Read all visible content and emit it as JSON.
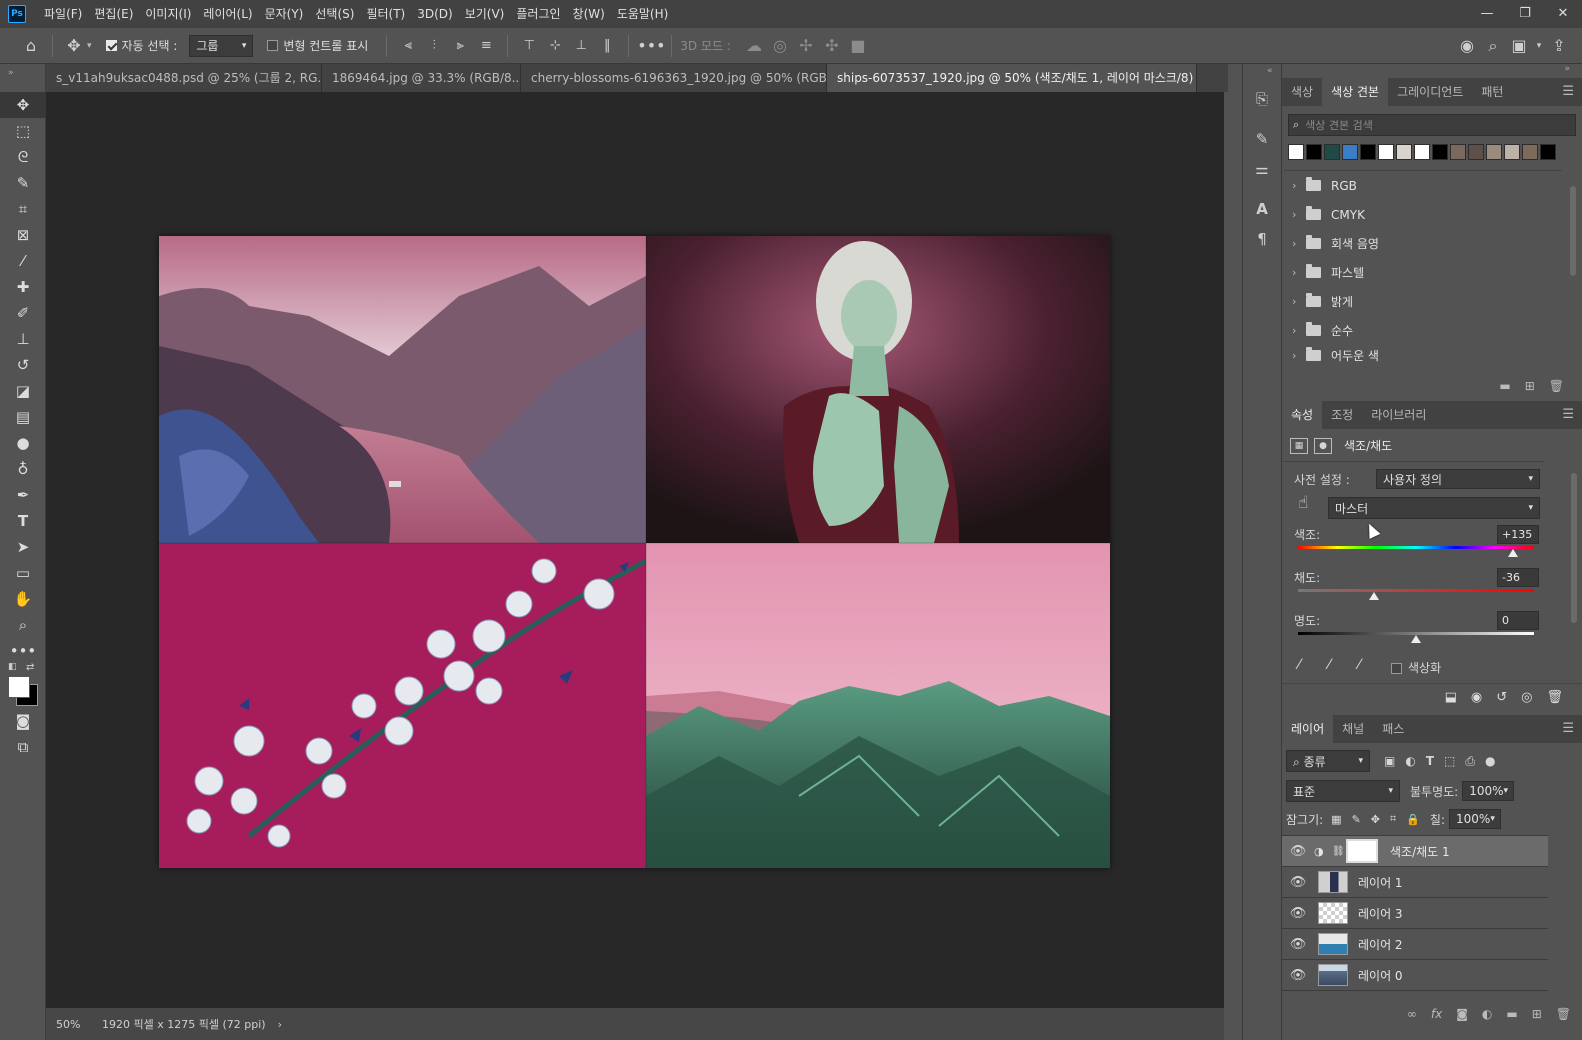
{
  "app": {
    "logo": "Ps"
  },
  "menubar": [
    "파일(F)",
    "편집(E)",
    "이미지(I)",
    "레이어(L)",
    "문자(Y)",
    "선택(S)",
    "필터(T)",
    "3D(D)",
    "보기(V)",
    "플러그인",
    "창(W)",
    "도움말(H)"
  ],
  "options": {
    "auto_select_label": "자동 선택 :",
    "auto_select_value": "그룹",
    "transform_label": "변형 컨트롤 표시",
    "mode_3d_label": "3D 모드 :"
  },
  "tabs": [
    {
      "label": "s_v11ah9uksac0488.psd @ 25% (그룹 2, RG...",
      "close": "×"
    },
    {
      "label": "1869464.jpg @ 33.3% (RGB/8...",
      "close": "×"
    },
    {
      "label": "cherry-blossoms-6196363_1920.jpg @ 50% (RGB/...",
      "close": "×"
    },
    {
      "label": "ships-6073537_1920.jpg @ 50% (색조/채도 1, 레이어 마스크/8) *",
      "close": "×"
    }
  ],
  "status": {
    "zoom": "50%",
    "doc_info": "1920 픽셀 x 1275 픽셀 (72 ppi)",
    "arrow": "›"
  },
  "swatches_panel": {
    "tabs": [
      "색상",
      "색상 견본",
      "그레이디언트",
      "패턴"
    ],
    "search_placeholder": "색상 견본 검색",
    "colors": [
      "#ffffff",
      "#000000",
      "#1f4a46",
      "#3b7ec5",
      "#000000",
      "#ffffff",
      "#d9d3cd",
      "#ffffff",
      "#000000",
      "#7a6a5e",
      "#5c5048",
      "#9a8b7f",
      "#bdb2a8",
      "#7e6a58",
      "#000000"
    ],
    "folders": [
      "RGB",
      "CMYK",
      "회색 음영",
      "파스텔",
      "밝게",
      "순수",
      "어두운 색"
    ]
  },
  "properties_panel": {
    "tabs": [
      "속성",
      "조정",
      "라이브러리"
    ],
    "title": "색조/채도",
    "preset_label": "사전 설정 :",
    "preset_value": "사용자 정의",
    "channel_value": "마스터",
    "hue_label": "색조:",
    "hue_value": "+135",
    "hue_position": 0.91,
    "saturation_label": "채도:",
    "saturation_value": "-36",
    "saturation_position": 0.32,
    "lightness_label": "명도:",
    "lightness_value": "0",
    "lightness_position": 0.5,
    "colorize_label": "색상화"
  },
  "layers_panel": {
    "tabs": [
      "레이어",
      "채널",
      "패스"
    ],
    "filter_value": "종류",
    "blend_value": "표준",
    "opacity_label": "불투명도:",
    "opacity_value": "100%",
    "lock_label": "잠그기:",
    "fill_label": "칠:",
    "fill_value": "100%",
    "layers": [
      {
        "name": "색조/채도 1"
      },
      {
        "name": "레이어 1"
      },
      {
        "name": "레이어 3"
      },
      {
        "name": "레이어 2"
      },
      {
        "name": "레이어 0"
      }
    ]
  }
}
